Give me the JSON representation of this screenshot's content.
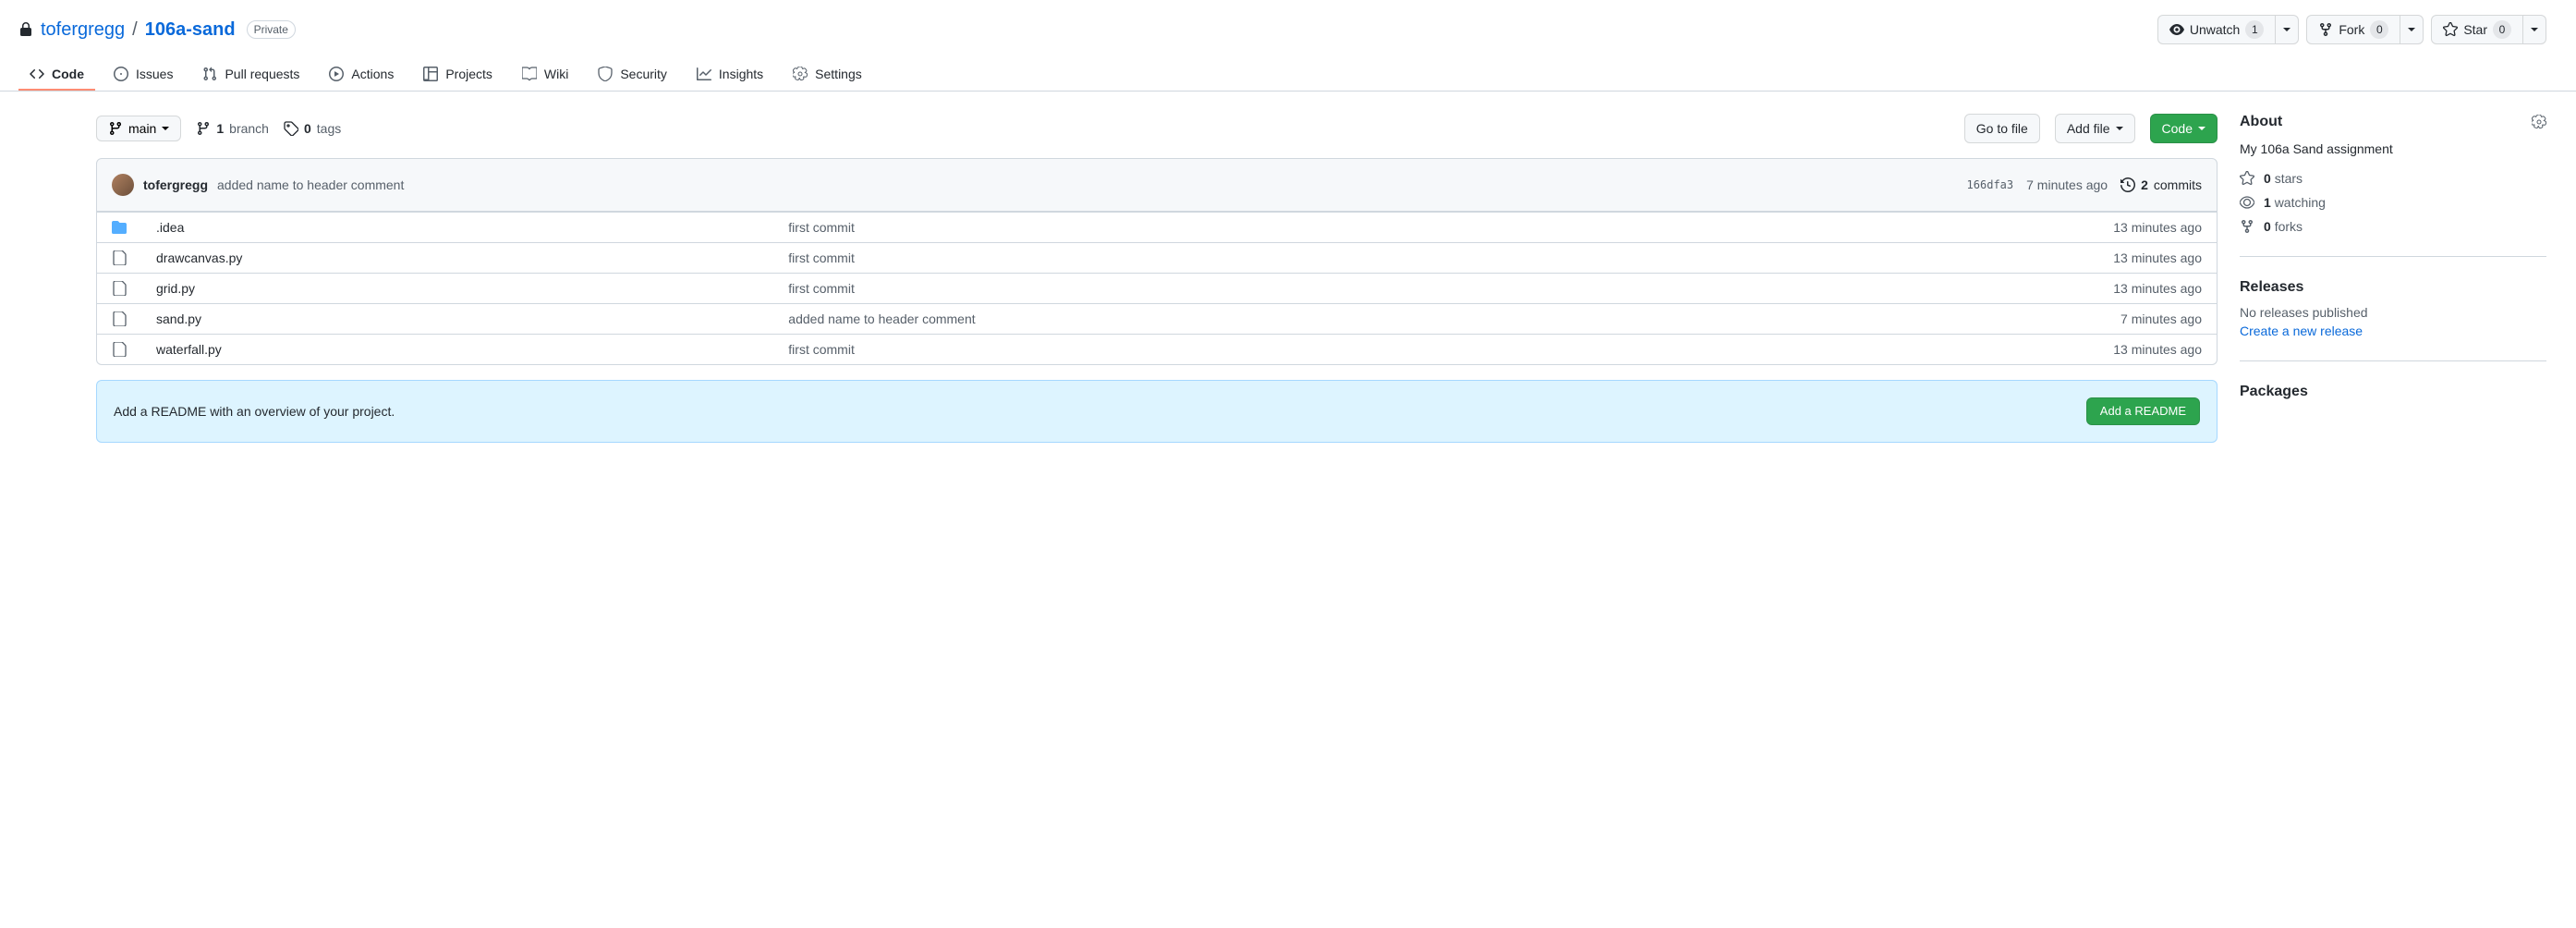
{
  "repo": {
    "owner": "tofergregg",
    "name": "106a-sand",
    "visibility": "Private"
  },
  "actions": {
    "unwatch_label": "Unwatch",
    "unwatch_count": "1",
    "fork_label": "Fork",
    "fork_count": "0",
    "star_label": "Star",
    "star_count": "0"
  },
  "tabs": {
    "code": "Code",
    "issues": "Issues",
    "pulls": "Pull requests",
    "actions": "Actions",
    "projects": "Projects",
    "wiki": "Wiki",
    "security": "Security",
    "insights": "Insights",
    "settings": "Settings"
  },
  "branch": {
    "current": "main",
    "branch_count": "1",
    "branch_word": "branch",
    "tag_count": "0",
    "tag_word": "tags"
  },
  "buttons": {
    "go_to_file": "Go to file",
    "add_file": "Add file",
    "code": "Code"
  },
  "latest_commit": {
    "author": "tofergregg",
    "message": "added name to header comment",
    "sha": "166dfa3",
    "time": "7 minutes ago",
    "commits_count": "2",
    "commits_word": "commits"
  },
  "files": [
    {
      "type": "dir",
      "name": ".idea",
      "msg": "first commit",
      "time": "13 minutes ago"
    },
    {
      "type": "file",
      "name": "drawcanvas.py",
      "msg": "first commit",
      "time": "13 minutes ago"
    },
    {
      "type": "file",
      "name": "grid.py",
      "msg": "first commit",
      "time": "13 minutes ago"
    },
    {
      "type": "file",
      "name": "sand.py",
      "msg": "added name to header comment",
      "time": "7 minutes ago"
    },
    {
      "type": "file",
      "name": "waterfall.py",
      "msg": "first commit",
      "time": "13 minutes ago"
    }
  ],
  "readme": {
    "prompt": "Add a README with an overview of your project.",
    "button": "Add a README"
  },
  "about": {
    "heading": "About",
    "description": "My 106a Sand assignment",
    "stars_count": "0",
    "stars_word": "stars",
    "watching_count": "1",
    "watching_word": "watching",
    "forks_count": "0",
    "forks_word": "forks"
  },
  "releases": {
    "heading": "Releases",
    "none": "No releases published",
    "create": "Create a new release"
  },
  "packages": {
    "heading": "Packages"
  }
}
